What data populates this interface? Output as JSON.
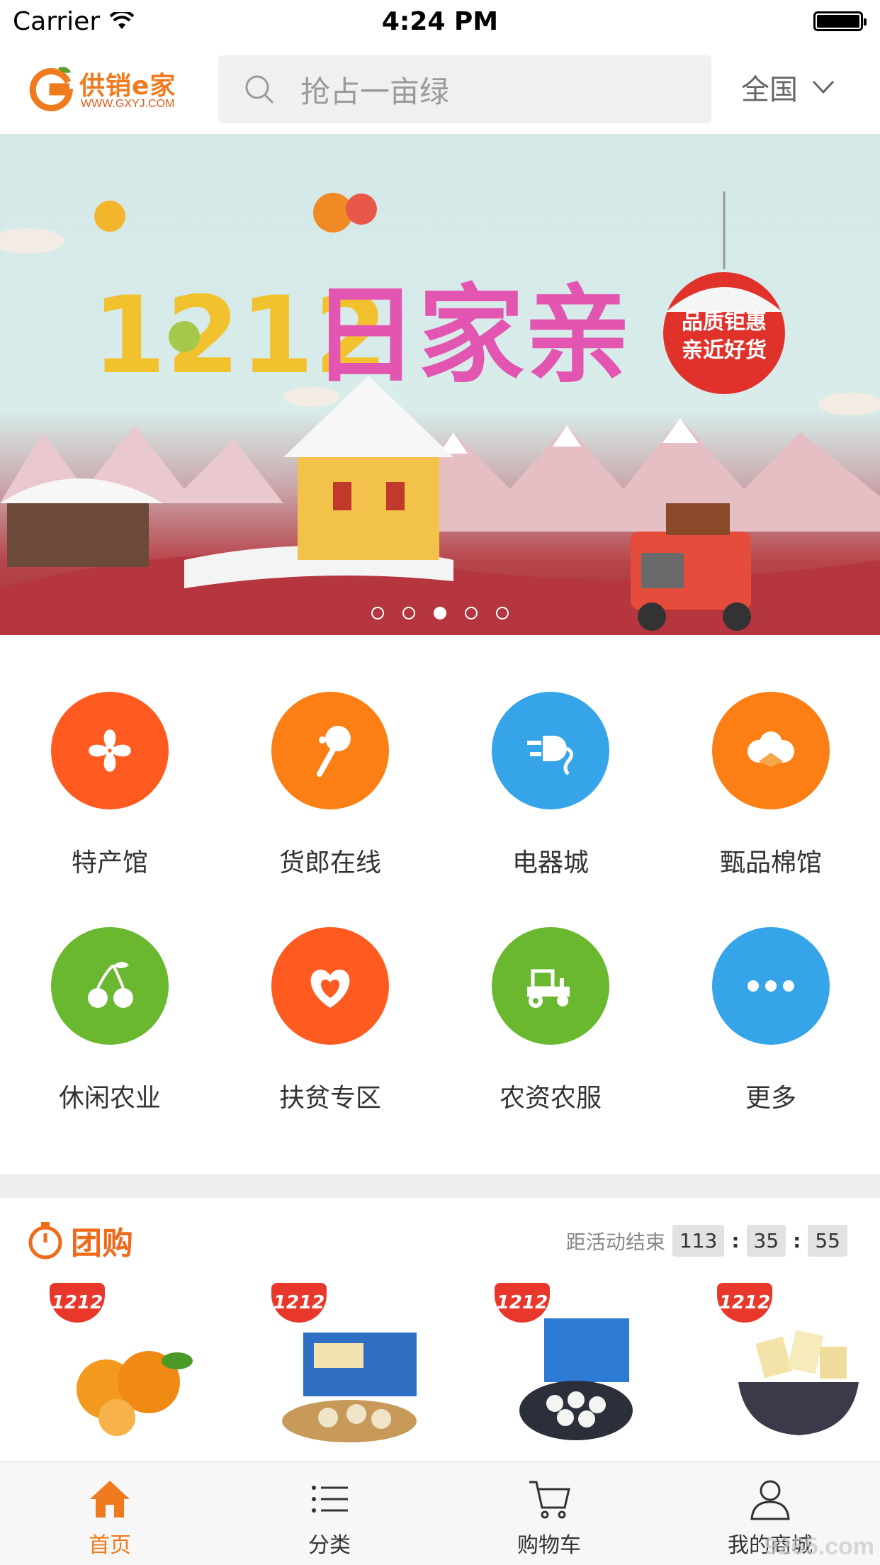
{
  "status_bar": {
    "carrier": "Carrier",
    "time": "4:24 PM"
  },
  "header": {
    "logo_text": "供销e家",
    "logo_url_text": "WWW.GXYJ.COM",
    "search_placeholder": "抢占一亩绿",
    "region": "全国"
  },
  "banner": {
    "headline": "1212日家亲",
    "promo_line1": "品质钜惠",
    "promo_line2": "亲近好货",
    "page_count": 5,
    "active_page": 3
  },
  "categories": [
    {
      "label": "特产馆",
      "icon": "clover-icon",
      "color": "#ff5a1f"
    },
    {
      "label": "货郎在线",
      "icon": "rattle-drum-icon",
      "color": "#fb7f14"
    },
    {
      "label": "电器城",
      "icon": "plug-icon",
      "color": "#36a4e8"
    },
    {
      "label": "甄品棉馆",
      "icon": "cotton-icon",
      "color": "#fb7f14"
    },
    {
      "label": "休闲农业",
      "icon": "cherry-icon",
      "color": "#6ab82f"
    },
    {
      "label": "扶贫专区",
      "icon": "heart-hands-icon",
      "color": "#ff5a1f"
    },
    {
      "label": "农资农服",
      "icon": "tractor-icon",
      "color": "#6ab82f"
    },
    {
      "label": "更多",
      "icon": "more-icon",
      "color": "#36a4e8"
    }
  ],
  "group_buy": {
    "title": "团购",
    "countdown_label": "距活动结束",
    "hours": "113",
    "minutes": "35",
    "seconds": "55",
    "products": [
      {
        "badge": "1212",
        "item": "oranges-image"
      },
      {
        "badge": "1212",
        "item": "biscuits-box-image"
      },
      {
        "badge": "1212",
        "item": "milk-tablets-image"
      },
      {
        "badge": "1212",
        "item": "snack-bowl-image"
      }
    ]
  },
  "tabbar": [
    {
      "label": "首页",
      "icon": "home-icon",
      "active": true
    },
    {
      "label": "分类",
      "icon": "list-icon",
      "active": false
    },
    {
      "label": "购物车",
      "icon": "cart-icon",
      "active": false
    },
    {
      "label": "我的商城",
      "icon": "user-icon",
      "active": false
    }
  ],
  "watermark": "9265.com",
  "colors": {
    "brand": "#f07a1e",
    "badge_red": "#e8372b",
    "active_tab": "#f07a1e"
  }
}
